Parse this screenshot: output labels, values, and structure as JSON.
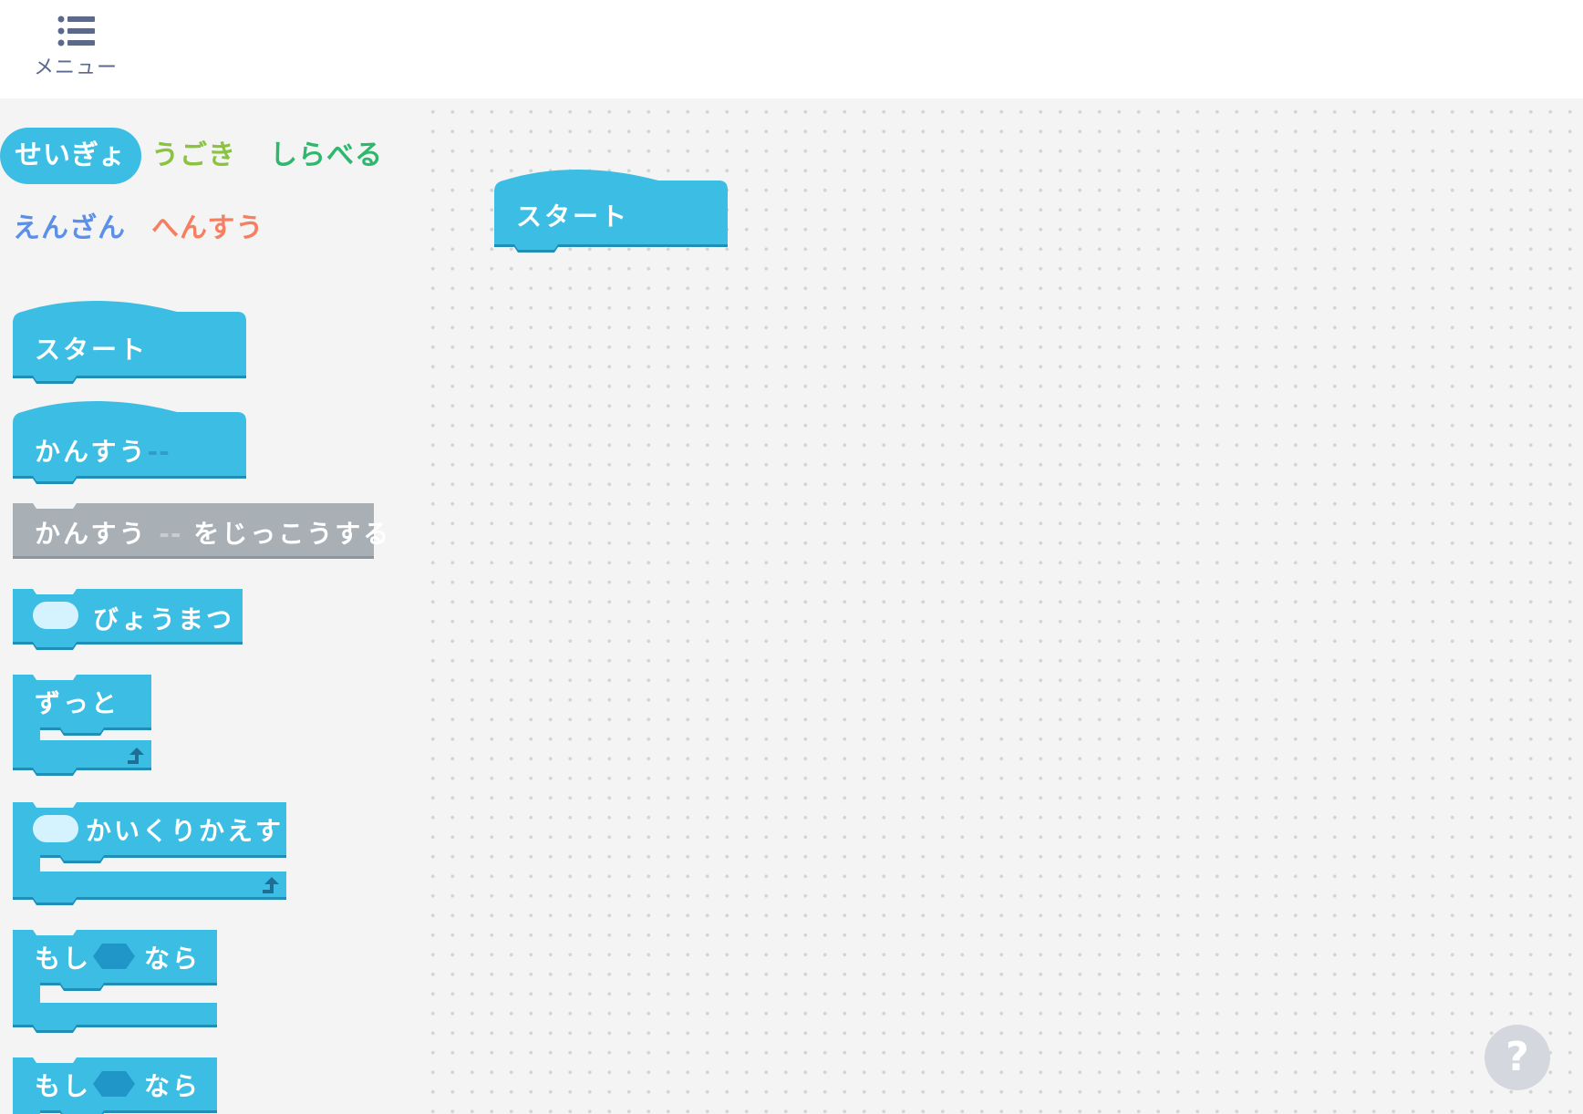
{
  "header": {
    "menu_label": "メニュー",
    "menu_icon": "list-icon"
  },
  "categories": [
    {
      "label": "せいぎょ",
      "color": "#3cbde3",
      "active": true
    },
    {
      "label": "うごき",
      "color": "#8ac43f",
      "active": false
    },
    {
      "label": "しらべる",
      "color": "#2eb86e",
      "active": false
    },
    {
      "label": "えんざん",
      "color": "#5b8fe8",
      "active": false
    },
    {
      "label": "へんすう",
      "color": "#f57f61",
      "active": false
    }
  ],
  "palette_blocks": {
    "start": "スタート",
    "function_def": {
      "label": "かんすう",
      "param": "--"
    },
    "function_call": {
      "label": "かんすう",
      "param": "--",
      "suffix": "をじっこうする"
    },
    "wait": "びょうまつ",
    "forever": "ずっと",
    "repeat": "かいくりかえす",
    "if1": {
      "prefix": "もし",
      "suffix": "なら"
    },
    "if2": {
      "prefix": "もし",
      "suffix": "なら"
    }
  },
  "workspace": {
    "start_block": "スタート"
  },
  "help": {
    "label": "?"
  },
  "colors": {
    "block": "#3cbde3",
    "block_shadow": "#1f8fb8",
    "call_block": "#a8b0b6",
    "input_oval": "#d5f3ff",
    "hex_input": "#1f95c8"
  }
}
